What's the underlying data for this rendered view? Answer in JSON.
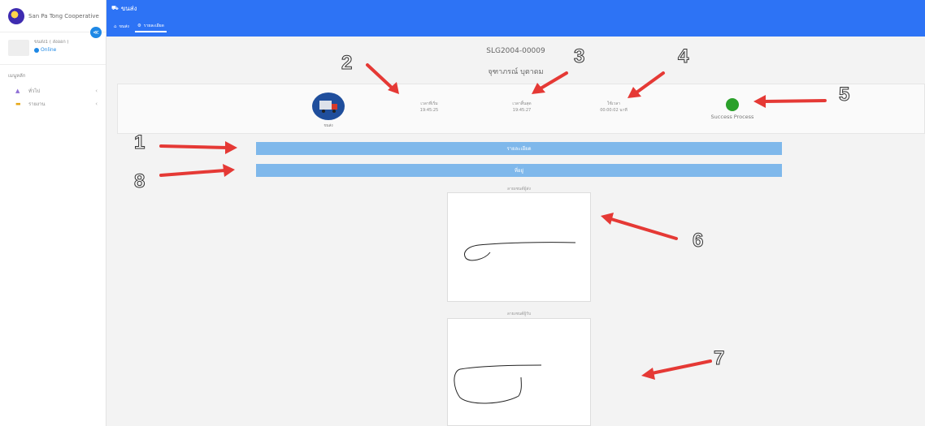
{
  "sidebar": {
    "brand": "San Pa Tong Cooperative",
    "user_name": "ขนส่ง1 ( ส่งออก )",
    "user_status": "Online",
    "menu_header": "เมนูหลัก",
    "items": [
      {
        "label": "ทั่วไป",
        "icon": "pyramid-icon"
      },
      {
        "label": "รายงาน",
        "icon": "report-icon"
      }
    ]
  },
  "topbar": {
    "title": "ขนส่ง"
  },
  "tabs": [
    {
      "label": "ขนส่ง",
      "icon": "home-icon"
    },
    {
      "label": "รายละเอียด",
      "icon": "gear-icon",
      "active": true
    }
  ],
  "document": {
    "number": "SLG2004-00009",
    "name": "จุฑาภรณ์ บุตาดม"
  },
  "info": {
    "truck_caption": "ขนส่ง",
    "start_label": "เวลาที่เริ่ม",
    "start_value": "19:45:25",
    "end_label": "เวลาสิ้นสุด",
    "end_value": "19:45:27",
    "duration_label": "ใช้เวลา",
    "duration_value": "00:00:02 นาที",
    "status_text": "Success Process",
    "status_color": "#2aa02a"
  },
  "sections": {
    "details": "รายละเอียด",
    "address": "ที่อยู่"
  },
  "signatures": {
    "sender_label": "ลายเซนต์ผู้ส่ง",
    "receiver_label": "ลายเซนต์ผู้รับ"
  },
  "annotations": [
    "1",
    "2",
    "3",
    "4",
    "5",
    "6",
    "7",
    "8"
  ],
  "colors": {
    "accent": "#2d73f5",
    "bar": "#7fb8eb",
    "arrow": "#e53935"
  }
}
